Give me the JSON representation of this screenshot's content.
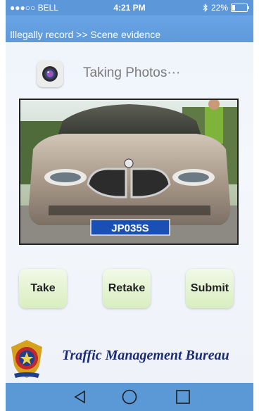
{
  "status_bar": {
    "carrier": "●●●○○ BELL",
    "time": "4:21 PM",
    "battery": "22%",
    "battery_level": 0.22
  },
  "header": {
    "breadcrumb": "Illegally record >> Scene evidence"
  },
  "camera_section": {
    "icon": "camera-icon",
    "title": "Taking Photos···"
  },
  "photo": {
    "plate_text": "JP035S"
  },
  "actions": {
    "take_label": "Take",
    "retake_label": "Retake",
    "submit_label": "Submit"
  },
  "footer": {
    "bureau_name": "Traffic Management Bureau",
    "emblem_icon": "police-emblem-icon"
  },
  "nav_bar": {
    "back_icon": "back-triangle-icon",
    "home_icon": "home-circle-icon",
    "recents_icon": "recents-square-icon"
  },
  "colors": {
    "accent": "#5b97d9",
    "button_bg": "#d8eebf",
    "bureau_text": "#1b2a7a"
  }
}
